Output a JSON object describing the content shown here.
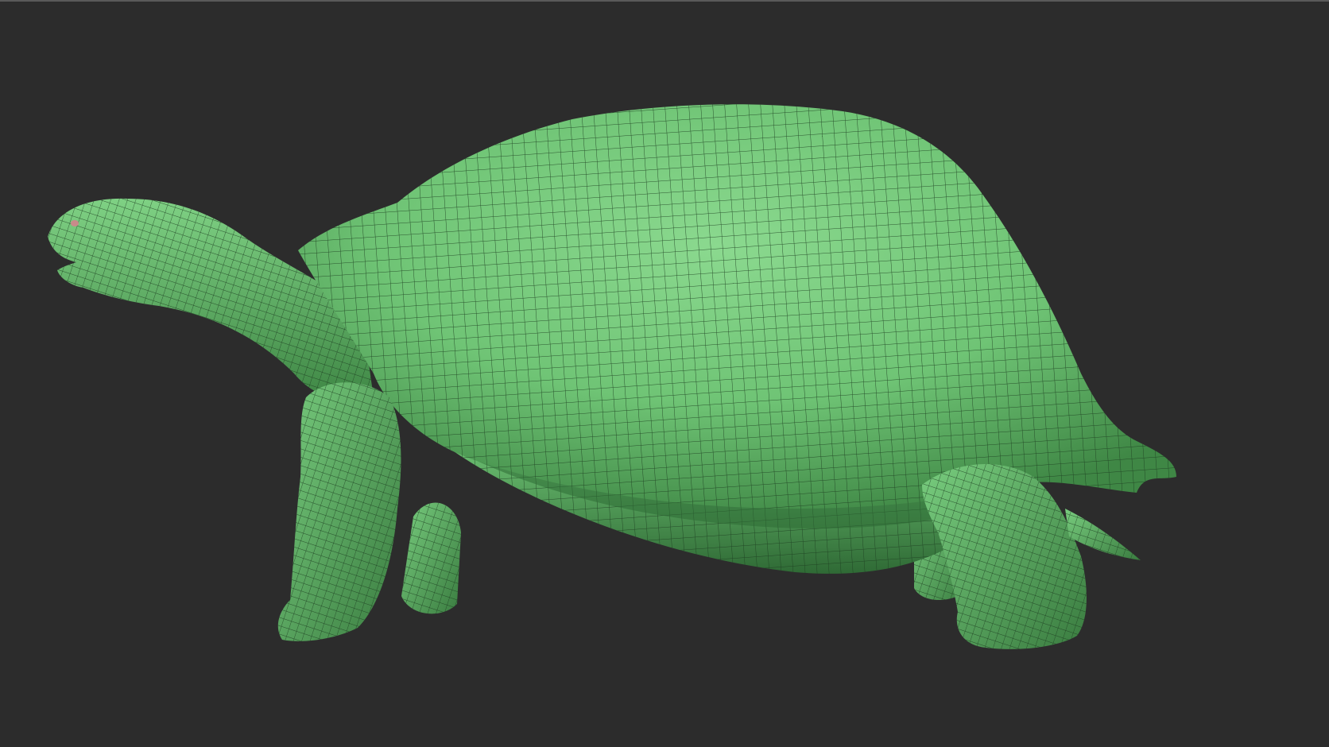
{
  "scene": {
    "subject": "tortoise-3d-model",
    "colors": {
      "background": "#2c2c2c",
      "edge": "#5a5a5a",
      "mesh_light": "#84d58a",
      "mesh_mid": "#5fb466",
      "mesh_dark": "#2e6b34",
      "wire": "#1d3f21",
      "eye": "#c98a8a"
    }
  }
}
